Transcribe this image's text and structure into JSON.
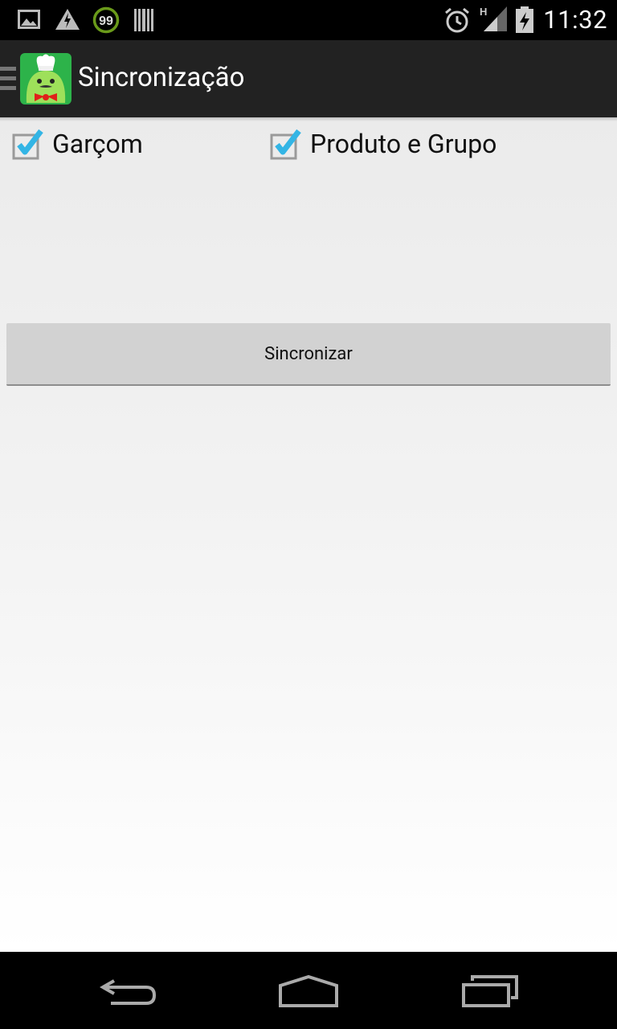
{
  "status_bar": {
    "notification_badge": "99",
    "network_type": "H",
    "time": "11:32"
  },
  "action_bar": {
    "title": "Sincronização"
  },
  "sync_options": [
    {
      "label": "Garçom",
      "checked": true
    },
    {
      "label": "Produto e Grupo",
      "checked": true
    }
  ],
  "sync_button": {
    "label": "Sincronizar"
  },
  "colors": {
    "action_bar_bg": "#222222",
    "checkbox_accent": "#33b5e5",
    "app_icon_green": "#2db34a",
    "button_bg": "#d2d2d2"
  }
}
